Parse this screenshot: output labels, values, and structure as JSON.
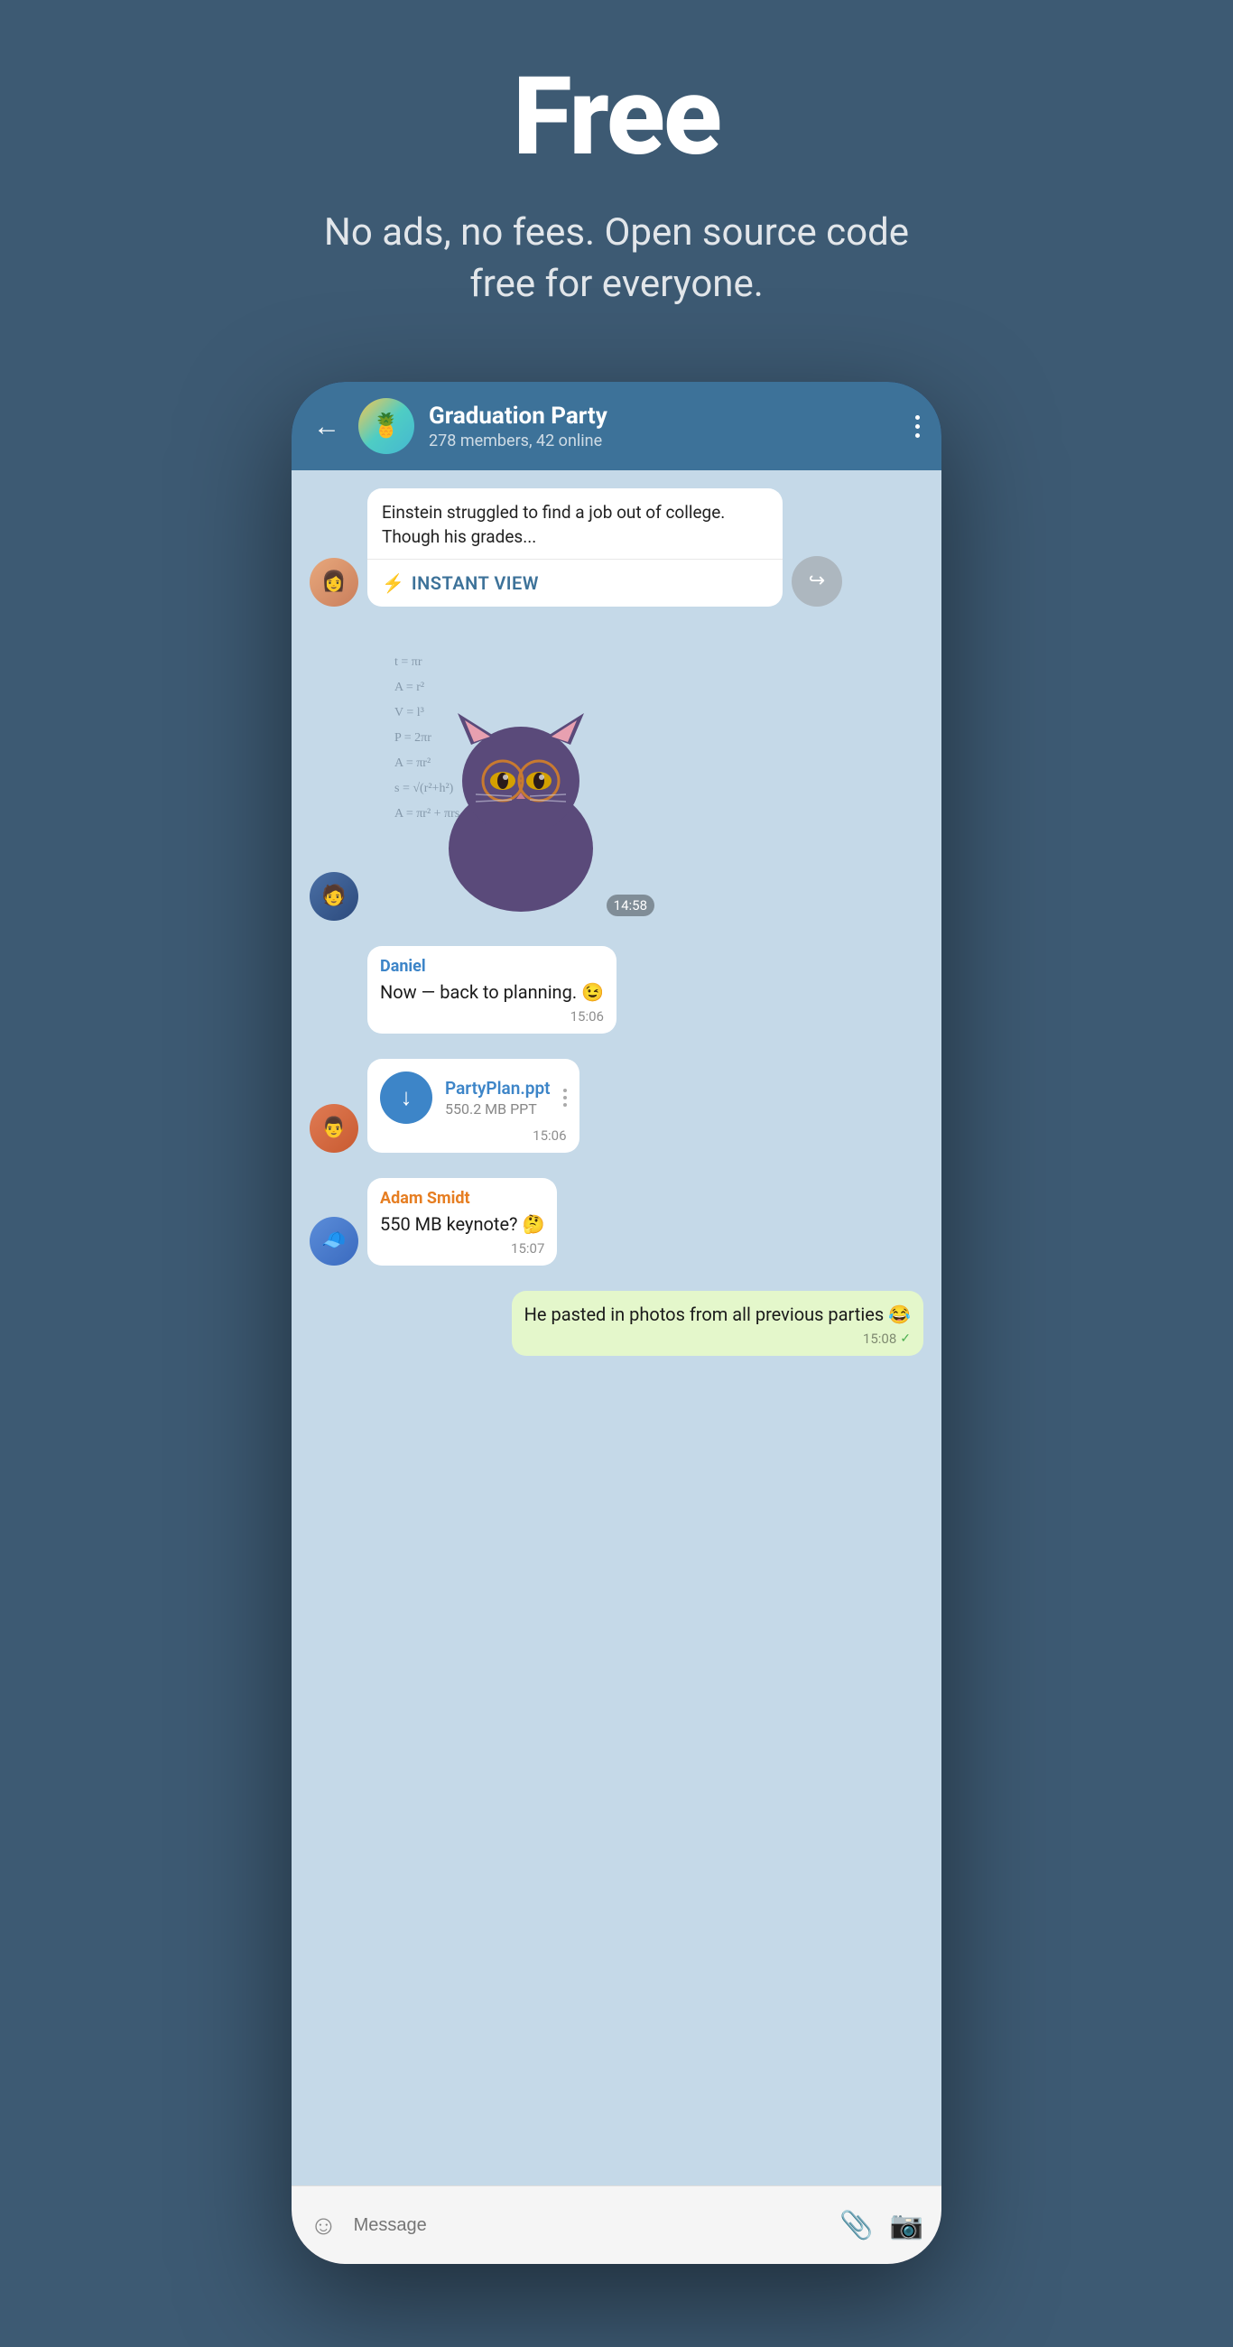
{
  "page": {
    "hero": {
      "title": "Free",
      "subtitle": "No ads, no fees. Open source code free for everyone."
    },
    "chat": {
      "header": {
        "back_label": "←",
        "group_name": "Graduation Party",
        "group_meta": "278 members, 42 online"
      },
      "messages": [
        {
          "id": "link-msg",
          "type": "link",
          "sender": "girl",
          "text": "Einstein struggled to find a job out of college. Though his grades...",
          "instant_view_label": "INSTANT VIEW"
        },
        {
          "id": "sticker-msg",
          "type": "sticker",
          "sender": "guy1",
          "timestamp": "14:58"
        },
        {
          "id": "daniel-msg",
          "type": "text",
          "sender": "daniel",
          "sender_name": "Daniel",
          "text": "Now — back to planning. 😉",
          "timestamp": "15:06"
        },
        {
          "id": "file-msg",
          "type": "file",
          "sender": "guy2",
          "file_name": "PartyPlan.ppt",
          "file_size": "550.2 MB PPT",
          "timestamp": "15:06"
        },
        {
          "id": "adam-msg",
          "type": "text",
          "sender": "adam",
          "sender_name": "Adam Smidt",
          "text": "550 MB keynote? 🤔",
          "timestamp": "15:07"
        },
        {
          "id": "sent-msg",
          "type": "sent",
          "text": "He pasted in photos from all previous parties 😂",
          "timestamp": "15:08",
          "delivered": true
        }
      ],
      "input_placeholder": "Message"
    }
  }
}
